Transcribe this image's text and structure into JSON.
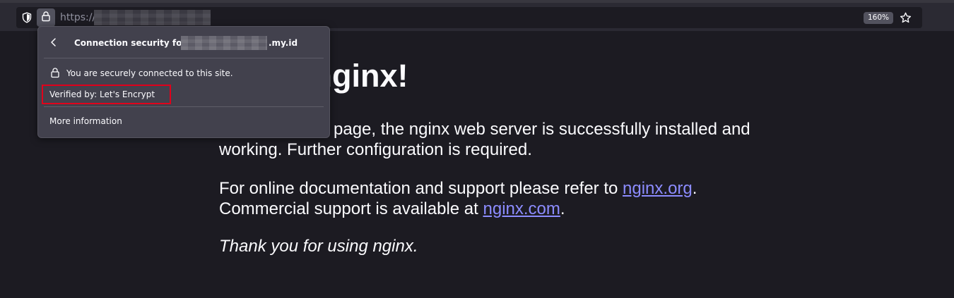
{
  "browser": {
    "url_prefix": "https://",
    "zoom": "160%",
    "icons": [
      "shield-icon",
      "lock-icon",
      "star-icon"
    ]
  },
  "security_popup": {
    "title_prefix": "Connection security for",
    "domain_suffix": ".my.id",
    "secure_text": "You are securely connected to this site.",
    "verified_text": "Verified by: Let's Encrypt",
    "more_info": "More information",
    "highlight_color": "#e0001b"
  },
  "page": {
    "heading_visible": "me to nginx!",
    "para1_line1": "page, the nginx web server is successfully installed and",
    "para1_line2": "working. Further configuration is required.",
    "para2_part1": "For online documentation and support please refer to",
    "link1": "nginx.org",
    "para2_part2": ".",
    "para2_part3": "Commercial support is available at",
    "link2": "nginx.com",
    "para2_part4": ".",
    "para3": "Thank you for using nginx.",
    "link_color": "#8c8cff"
  }
}
